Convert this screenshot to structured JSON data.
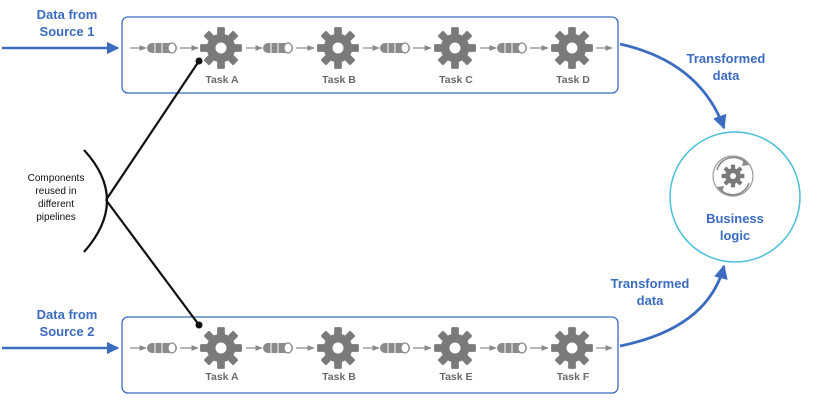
{
  "sources": {
    "top": {
      "line1": "Data from",
      "line2": "Source 1"
    },
    "bottom": {
      "line1": "Data from",
      "line2": "Source 2"
    }
  },
  "pipelines": {
    "top": {
      "tasks": [
        "Task A",
        "Task B",
        "Task C",
        "Task D"
      ]
    },
    "bottom": {
      "tasks": [
        "Task A",
        "Task B",
        "Task E",
        "Task F"
      ]
    }
  },
  "transformed": {
    "top": {
      "line1": "Transformed",
      "line2": "data"
    },
    "bottom": {
      "line1": "Transformed",
      "line2": "data"
    }
  },
  "business": {
    "line1": "Business",
    "line2": "logic"
  },
  "components_note": [
    "Components",
    "reused in",
    "different",
    "pipelines"
  ],
  "icons": {
    "task": "gear-icon",
    "queue": "queue-icon",
    "business": "rotating-gear-icon"
  },
  "colors": {
    "accent_blue": "#3b6cc0",
    "pipeline_border": "#3b6cc0",
    "circle_border": "#4bbfd9",
    "gear": "#7a7a7a",
    "task_text": "#6a6a6a"
  }
}
